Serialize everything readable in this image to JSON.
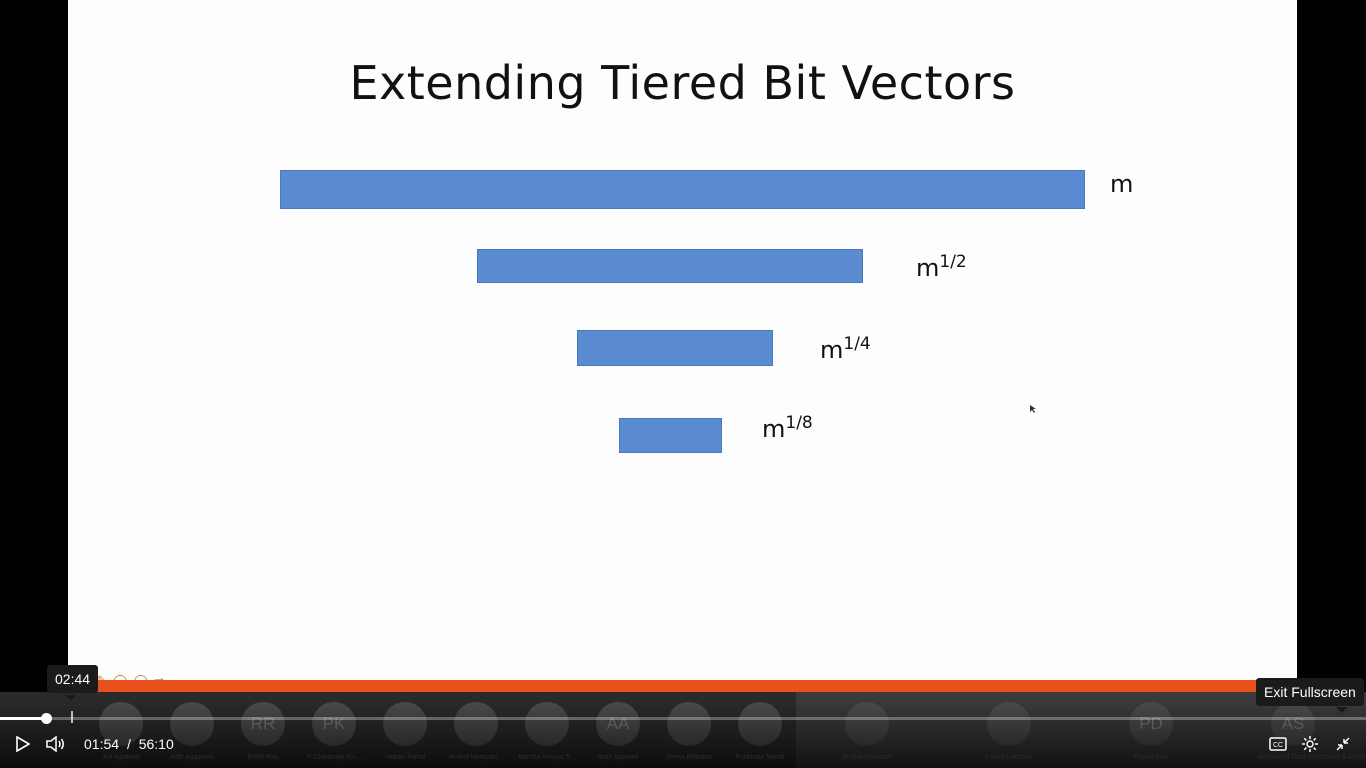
{
  "slide": {
    "title": "Extending Tiered Bit Vectors",
    "labels": [
      {
        "base": "m",
        "exp": ""
      },
      {
        "base": "m",
        "exp": "1/2"
      },
      {
        "base": "m",
        "exp": "1/4"
      },
      {
        "base": "m",
        "exp": "1/8"
      }
    ]
  },
  "participants": [
    {
      "initials": "",
      "name": "Avi Agrawal"
    },
    {
      "initials": "",
      "name": "Aditi Aggarwal"
    },
    {
      "initials": "RR",
      "name": "Rohit Rao"
    },
    {
      "initials": "PK",
      "name": "P Chaitanya Ku..."
    },
    {
      "initials": "",
      "name": "Vaibav Rahul"
    },
    {
      "initials": "",
      "name": "Arvind Narayan..."
    },
    {
      "initials": "",
      "name": "Barsha Vinaya S..."
    },
    {
      "initials": "AA",
      "name": "Arpit Agarwal"
    },
    {
      "initials": "",
      "name": "Jeena Bhaskar"
    },
    {
      "initials": "",
      "name": "Prabhata Nandi"
    },
    {
      "initials": "",
      "name": "Sudha Senapati"
    },
    {
      "initials": "",
      "name": "Laxmi Lakshmi"
    },
    {
      "initials": "PD",
      "name": "Prajna Das"
    },
    {
      "initials": "AS",
      "name": "Advanced Data Structures & Algorit..."
    }
  ],
  "player": {
    "current_time": "01:54",
    "separator": "/",
    "duration": "56:10",
    "hover_time": "02:44",
    "exit_fullscreen_tooltip": "Exit Fullscreen",
    "progress_fraction": 0.0338,
    "icons": {
      "play": "play-icon",
      "volume": "volume-icon",
      "captions": "captions-icon",
      "settings": "gear-icon",
      "exit_fullscreen": "exit-fullscreen-icon"
    }
  }
}
